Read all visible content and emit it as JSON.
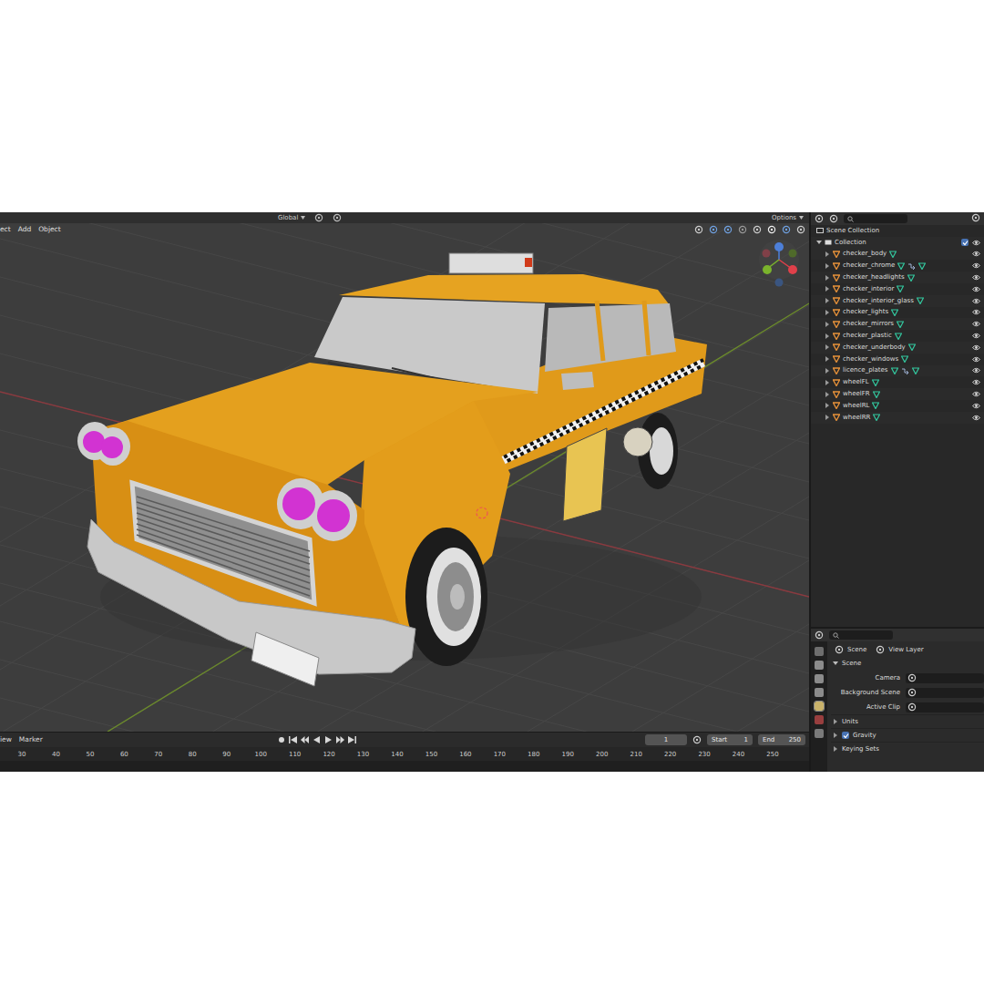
{
  "top_strip": {
    "orientation": "Global",
    "options": "Options"
  },
  "viewport": {
    "menu": [
      "ect",
      "Add",
      "Object"
    ]
  },
  "timeline": {
    "menu": [
      "iew",
      "Marker"
    ],
    "current_frame": "1",
    "start_label": "Start",
    "start": "1",
    "end_label": "End",
    "end": "250",
    "ruler": [
      "30",
      "40",
      "50",
      "60",
      "70",
      "80",
      "90",
      "100",
      "110",
      "120",
      "130",
      "140",
      "150",
      "160",
      "170",
      "180",
      "190",
      "200",
      "210",
      "220",
      "230",
      "240",
      "250"
    ]
  },
  "outliner": {
    "root": "Scene Collection",
    "collection": {
      "name": "Collection",
      "expanded": true,
      "checked": true,
      "visible": true
    },
    "objects": [
      {
        "name": "checker_body",
        "has_modifier": false,
        "visible": true
      },
      {
        "name": "checker_chrome",
        "has_modifier": true,
        "visible": true
      },
      {
        "name": "checker_headlights",
        "has_modifier": false,
        "visible": true
      },
      {
        "name": "checker_interior",
        "has_modifier": false,
        "visible": true
      },
      {
        "name": "checker_interior_glass",
        "has_modifier": false,
        "visible": true
      },
      {
        "name": "checker_lights",
        "has_modifier": false,
        "visible": true
      },
      {
        "name": "checker_mirrors",
        "has_modifier": false,
        "visible": true
      },
      {
        "name": "checker_plastic",
        "has_modifier": false,
        "visible": true
      },
      {
        "name": "checker_underbody",
        "has_modifier": false,
        "visible": true
      },
      {
        "name": "checker_windows",
        "has_modifier": false,
        "visible": true
      },
      {
        "name": "licence_plates",
        "has_modifier": true,
        "visible": true
      },
      {
        "name": "wheelFL",
        "has_modifier": false,
        "visible": true
      },
      {
        "name": "wheelFR",
        "has_modifier": false,
        "visible": true
      },
      {
        "name": "wheelRL",
        "has_modifier": false,
        "visible": true
      },
      {
        "name": "wheelRR",
        "has_modifier": false,
        "visible": true
      }
    ]
  },
  "properties": {
    "breadcrumb": [
      "Scene",
      "View Layer"
    ],
    "section": {
      "label": "Scene",
      "expanded": true
    },
    "fields": [
      {
        "label": "Camera"
      },
      {
        "label": "Background Scene"
      },
      {
        "label": "Active Clip"
      }
    ],
    "panels": [
      {
        "label": "Units",
        "kind": "panel",
        "expanded": false
      },
      {
        "label": "Gravity",
        "kind": "checkbox",
        "checked": true,
        "expanded": false
      },
      {
        "label": "Keying Sets",
        "kind": "panel",
        "expanded": false
      }
    ]
  }
}
